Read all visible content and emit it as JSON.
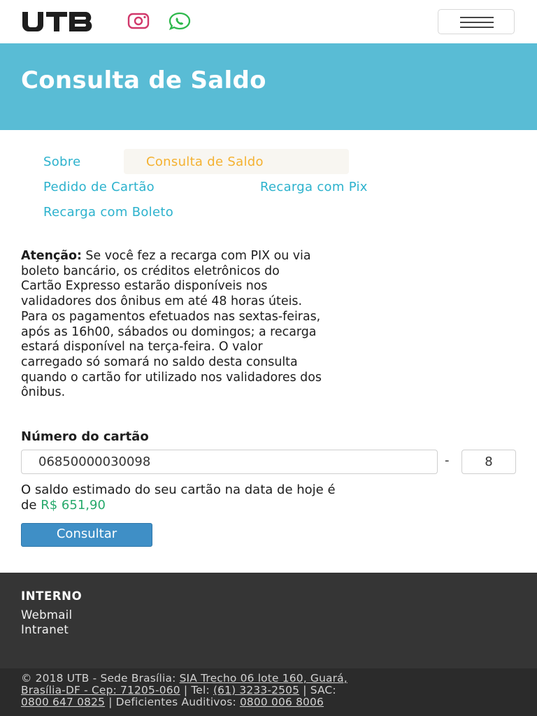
{
  "header": {
    "logo_text": "UTB",
    "menu_label": "Menu"
  },
  "banner": {
    "title": "Consulta de Saldo"
  },
  "tabs": [
    {
      "label": "Sobre",
      "active": false
    },
    {
      "label": "Consulta de Saldo",
      "active": true
    },
    {
      "label": "Pedido de Cartão",
      "active": false
    },
    {
      "label": "Recarga com Pix",
      "active": false
    },
    {
      "label": "Recarga com Boleto",
      "active": false
    }
  ],
  "notice": {
    "lead": "Atenção:",
    "lines": [
      " Se você fez a recarga com PIX ou via",
      "boleto bancário, os créditos eletrônicos do",
      "Cartão Expresso estarão disponíveis nos",
      "validadores dos ônibus em até 48 horas úteis.",
      "Para os pagamentos efetuados nas sextas-feiras,",
      "após as 16h00, sábados ou domingos; a recarga",
      "estará disponível na terça-feira. O valor",
      "carregado só somará no saldo desta consulta",
      "quando o cartão for utilizado nos validadores dos",
      "ônibus."
    ]
  },
  "form": {
    "label": "Número do cartão",
    "card_number": "06850000030098",
    "separator": "-",
    "check_digit": "8",
    "result_line1": "O saldo estimado do seu cartão na data de hoje é",
    "result_prefix": "de ",
    "balance": "R$ 651,90",
    "submit_label": "Consultar"
  },
  "footer": {
    "title": "INTERNO",
    "links": [
      "Webmail",
      "Intranet"
    ],
    "copyright_1": "© 2018 UTB - Sede Brasília: ",
    "address_1": "SIA Trecho 06 lote 160, Guará,",
    "address_2": "Brasília-DF - Cep: 71205-060",
    "tel_label": " | Tel: ",
    "tel": "(61) 3233-2505",
    "sac_label": " | SAC:",
    "sac": "0800 647 0825",
    "deaf_label": " | Deficientes Auditivos: ",
    "deaf": "0800 006 8006"
  },
  "colors": {
    "banner": "#59bcd5",
    "tab_link": "#2cb2cd",
    "tab_active": "#f4b130",
    "balance": "#26a96b",
    "button": "#3f8fc6",
    "footer": "#353535"
  }
}
